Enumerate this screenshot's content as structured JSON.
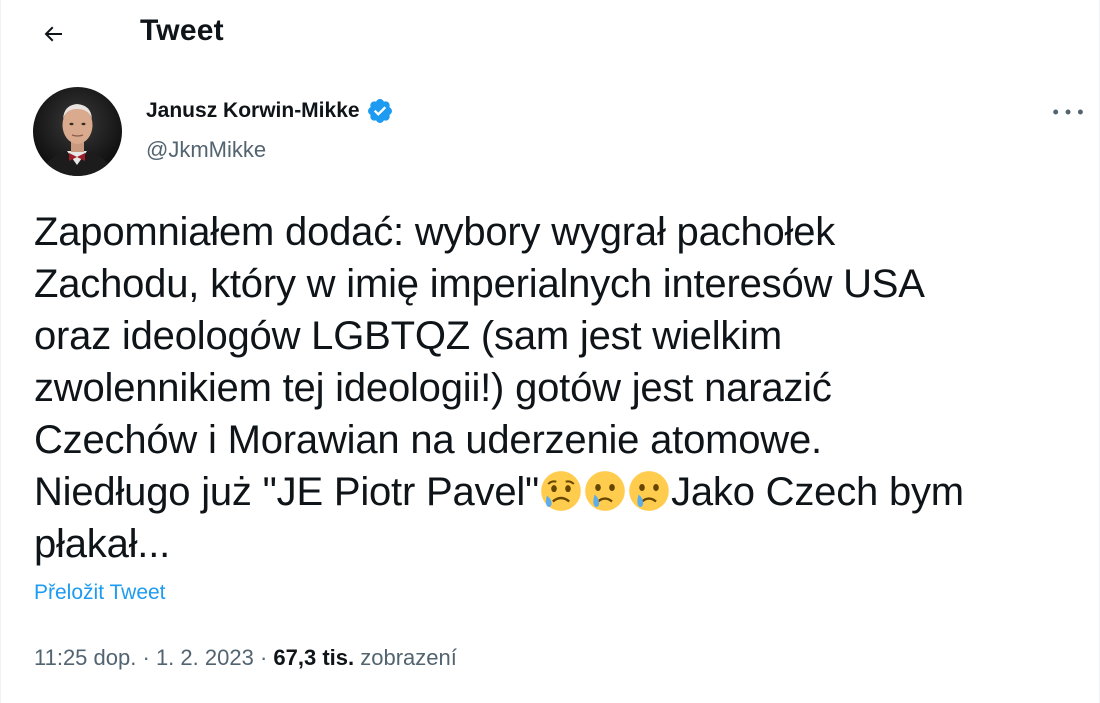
{
  "header": {
    "title": "Tweet",
    "back_icon": "arrow-left-icon"
  },
  "author": {
    "name": "Janusz Korwin-Mikke",
    "handle": "@JkmMikke",
    "verified": true,
    "verified_color": "#1d9bf0",
    "avatar_icon": "avatar-photo"
  },
  "tweet": {
    "lines": [
      "Zapomniałem dodać: wybory wygrał pachołek",
      "Zachodu, który w imię imperialnych interesów USA",
      "oraz ideologów LGBTQZ (sam jest wielkim",
      "zwolennikiem tej ideologii!) gotów jest narazić",
      "Czechów i Morawian na uderzenie atomowe."
    ],
    "line6_before": "Niedługo już \"JE Piotr Pavel\"",
    "line6_emojis": [
      "sad-sweat-face-emoji",
      "crying-face-emoji",
      "crying-face-emoji"
    ],
    "line6_after": "Jako Czech bym",
    "line7": "płakał..."
  },
  "translate_label": "Přeložit Tweet",
  "meta": {
    "time": "11:25 dop.",
    "separator": "·",
    "date": "1. 2. 2023",
    "views_count": "67,3 tis.",
    "views_label": "zobrazení"
  },
  "colors": {
    "accent": "#1d9bf0",
    "text_primary": "#0f1419",
    "text_secondary": "#536471"
  }
}
